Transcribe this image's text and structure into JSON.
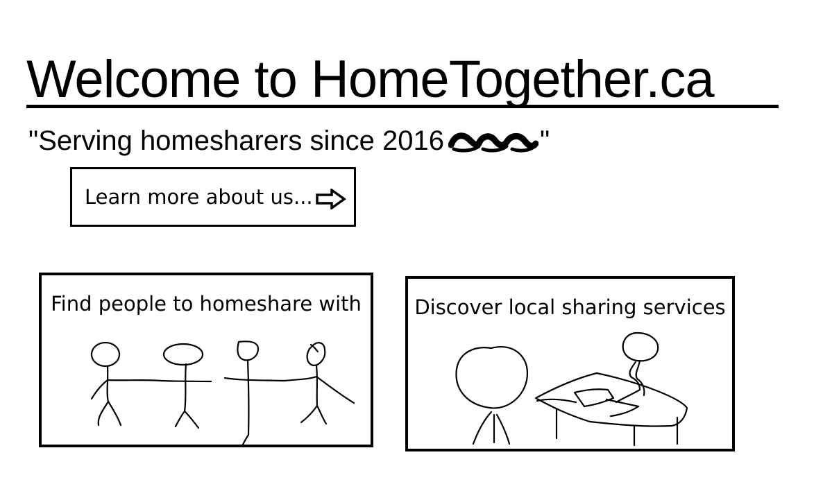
{
  "header": {
    "title": "Welcome to HomeTogether.ca",
    "tagline_text": "\"Serving homesharers since 2016",
    "tagline_close": "\""
  },
  "learn_more": {
    "label": "Learn more about us..."
  },
  "panels": [
    {
      "label": "Find people to homeshare with"
    },
    {
      "label": "Discover local sharing services"
    }
  ],
  "icons": {
    "arrow": "right-arrow-icon",
    "scribble": "scribble-icon"
  },
  "colors": {
    "background": "#ffffff",
    "ink": "#000000"
  }
}
